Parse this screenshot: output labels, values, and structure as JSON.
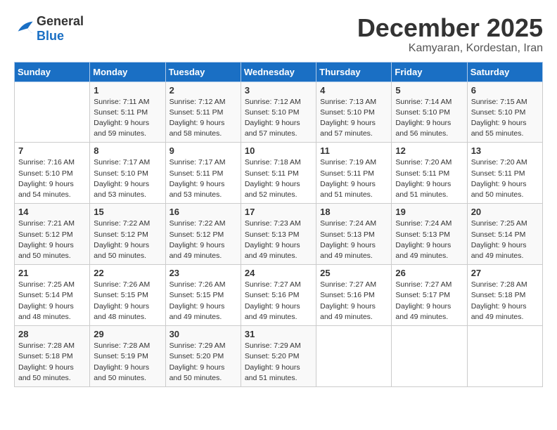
{
  "header": {
    "logo_general": "General",
    "logo_blue": "Blue",
    "month_title": "December 2025",
    "location": "Kamyaran, Kordestan, Iran"
  },
  "weekdays": [
    "Sunday",
    "Monday",
    "Tuesday",
    "Wednesday",
    "Thursday",
    "Friday",
    "Saturday"
  ],
  "weeks": [
    [
      {
        "day": "",
        "sunrise": "",
        "sunset": "",
        "daylight": ""
      },
      {
        "day": "1",
        "sunrise": "Sunrise: 7:11 AM",
        "sunset": "Sunset: 5:11 PM",
        "daylight": "Daylight: 9 hours and 59 minutes."
      },
      {
        "day": "2",
        "sunrise": "Sunrise: 7:12 AM",
        "sunset": "Sunset: 5:11 PM",
        "daylight": "Daylight: 9 hours and 58 minutes."
      },
      {
        "day": "3",
        "sunrise": "Sunrise: 7:12 AM",
        "sunset": "Sunset: 5:10 PM",
        "daylight": "Daylight: 9 hours and 57 minutes."
      },
      {
        "day": "4",
        "sunrise": "Sunrise: 7:13 AM",
        "sunset": "Sunset: 5:10 PM",
        "daylight": "Daylight: 9 hours and 57 minutes."
      },
      {
        "day": "5",
        "sunrise": "Sunrise: 7:14 AM",
        "sunset": "Sunset: 5:10 PM",
        "daylight": "Daylight: 9 hours and 56 minutes."
      },
      {
        "day": "6",
        "sunrise": "Sunrise: 7:15 AM",
        "sunset": "Sunset: 5:10 PM",
        "daylight": "Daylight: 9 hours and 55 minutes."
      }
    ],
    [
      {
        "day": "7",
        "sunrise": "Sunrise: 7:16 AM",
        "sunset": "Sunset: 5:10 PM",
        "daylight": "Daylight: 9 hours and 54 minutes."
      },
      {
        "day": "8",
        "sunrise": "Sunrise: 7:17 AM",
        "sunset": "Sunset: 5:10 PM",
        "daylight": "Daylight: 9 hours and 53 minutes."
      },
      {
        "day": "9",
        "sunrise": "Sunrise: 7:17 AM",
        "sunset": "Sunset: 5:11 PM",
        "daylight": "Daylight: 9 hours and 53 minutes."
      },
      {
        "day": "10",
        "sunrise": "Sunrise: 7:18 AM",
        "sunset": "Sunset: 5:11 PM",
        "daylight": "Daylight: 9 hours and 52 minutes."
      },
      {
        "day": "11",
        "sunrise": "Sunrise: 7:19 AM",
        "sunset": "Sunset: 5:11 PM",
        "daylight": "Daylight: 9 hours and 51 minutes."
      },
      {
        "day": "12",
        "sunrise": "Sunrise: 7:20 AM",
        "sunset": "Sunset: 5:11 PM",
        "daylight": "Daylight: 9 hours and 51 minutes."
      },
      {
        "day": "13",
        "sunrise": "Sunrise: 7:20 AM",
        "sunset": "Sunset: 5:11 PM",
        "daylight": "Daylight: 9 hours and 50 minutes."
      }
    ],
    [
      {
        "day": "14",
        "sunrise": "Sunrise: 7:21 AM",
        "sunset": "Sunset: 5:12 PM",
        "daylight": "Daylight: 9 hours and 50 minutes."
      },
      {
        "day": "15",
        "sunrise": "Sunrise: 7:22 AM",
        "sunset": "Sunset: 5:12 PM",
        "daylight": "Daylight: 9 hours and 50 minutes."
      },
      {
        "day": "16",
        "sunrise": "Sunrise: 7:22 AM",
        "sunset": "Sunset: 5:12 PM",
        "daylight": "Daylight: 9 hours and 49 minutes."
      },
      {
        "day": "17",
        "sunrise": "Sunrise: 7:23 AM",
        "sunset": "Sunset: 5:13 PM",
        "daylight": "Daylight: 9 hours and 49 minutes."
      },
      {
        "day": "18",
        "sunrise": "Sunrise: 7:24 AM",
        "sunset": "Sunset: 5:13 PM",
        "daylight": "Daylight: 9 hours and 49 minutes."
      },
      {
        "day": "19",
        "sunrise": "Sunrise: 7:24 AM",
        "sunset": "Sunset: 5:13 PM",
        "daylight": "Daylight: 9 hours and 49 minutes."
      },
      {
        "day": "20",
        "sunrise": "Sunrise: 7:25 AM",
        "sunset": "Sunset: 5:14 PM",
        "daylight": "Daylight: 9 hours and 49 minutes."
      }
    ],
    [
      {
        "day": "21",
        "sunrise": "Sunrise: 7:25 AM",
        "sunset": "Sunset: 5:14 PM",
        "daylight": "Daylight: 9 hours and 48 minutes."
      },
      {
        "day": "22",
        "sunrise": "Sunrise: 7:26 AM",
        "sunset": "Sunset: 5:15 PM",
        "daylight": "Daylight: 9 hours and 48 minutes."
      },
      {
        "day": "23",
        "sunrise": "Sunrise: 7:26 AM",
        "sunset": "Sunset: 5:15 PM",
        "daylight": "Daylight: 9 hours and 49 minutes."
      },
      {
        "day": "24",
        "sunrise": "Sunrise: 7:27 AM",
        "sunset": "Sunset: 5:16 PM",
        "daylight": "Daylight: 9 hours and 49 minutes."
      },
      {
        "day": "25",
        "sunrise": "Sunrise: 7:27 AM",
        "sunset": "Sunset: 5:16 PM",
        "daylight": "Daylight: 9 hours and 49 minutes."
      },
      {
        "day": "26",
        "sunrise": "Sunrise: 7:27 AM",
        "sunset": "Sunset: 5:17 PM",
        "daylight": "Daylight: 9 hours and 49 minutes."
      },
      {
        "day": "27",
        "sunrise": "Sunrise: 7:28 AM",
        "sunset": "Sunset: 5:18 PM",
        "daylight": "Daylight: 9 hours and 49 minutes."
      }
    ],
    [
      {
        "day": "28",
        "sunrise": "Sunrise: 7:28 AM",
        "sunset": "Sunset: 5:18 PM",
        "daylight": "Daylight: 9 hours and 50 minutes."
      },
      {
        "day": "29",
        "sunrise": "Sunrise: 7:28 AM",
        "sunset": "Sunset: 5:19 PM",
        "daylight": "Daylight: 9 hours and 50 minutes."
      },
      {
        "day": "30",
        "sunrise": "Sunrise: 7:29 AM",
        "sunset": "Sunset: 5:20 PM",
        "daylight": "Daylight: 9 hours and 50 minutes."
      },
      {
        "day": "31",
        "sunrise": "Sunrise: 7:29 AM",
        "sunset": "Sunset: 5:20 PM",
        "daylight": "Daylight: 9 hours and 51 minutes."
      },
      {
        "day": "",
        "sunrise": "",
        "sunset": "",
        "daylight": ""
      },
      {
        "day": "",
        "sunrise": "",
        "sunset": "",
        "daylight": ""
      },
      {
        "day": "",
        "sunrise": "",
        "sunset": "",
        "daylight": ""
      }
    ]
  ]
}
